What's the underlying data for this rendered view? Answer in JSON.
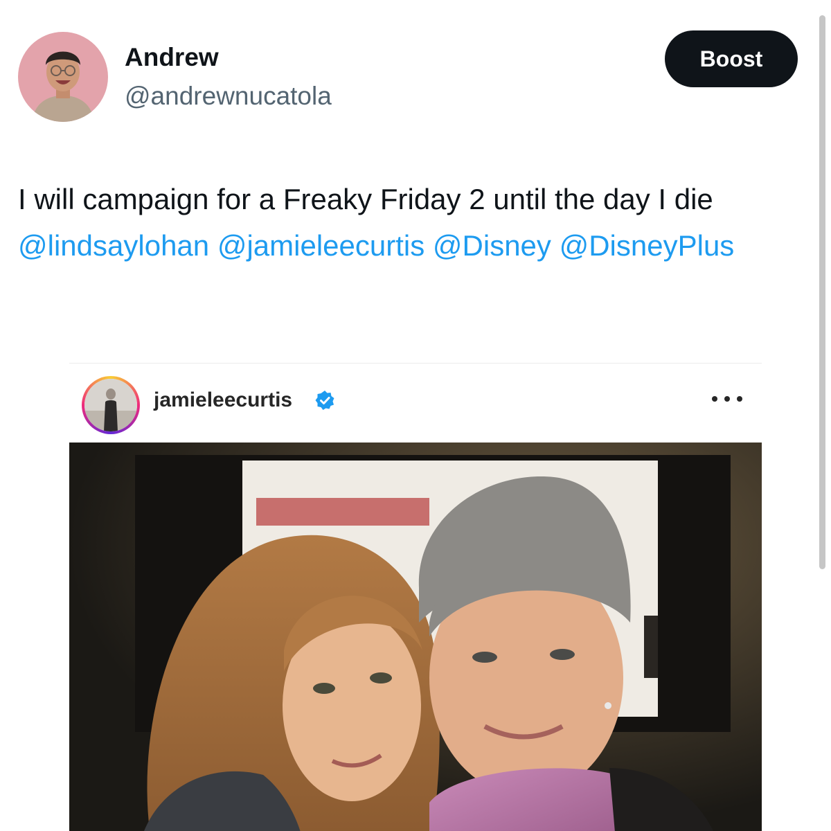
{
  "tweet": {
    "author_name": "Andrew",
    "author_handle": "@andrewnucatola",
    "boost_label": "Boost",
    "text_before": "I will campaign for a Freaky Friday 2 until the day I die ",
    "mentions": [
      "@lindsaylohan",
      "@jamieleecurtis",
      "@Disney",
      "@DisneyPlus"
    ]
  },
  "embed": {
    "username": "jamieleecurtis",
    "verified": true,
    "more_icon": "more-horizontal-icon"
  },
  "colors": {
    "text": "#0f1419",
    "handle": "#536471",
    "mention": "#1d9bf0",
    "boost_bg": "#0f1419",
    "verified": "#1d9bf0"
  }
}
